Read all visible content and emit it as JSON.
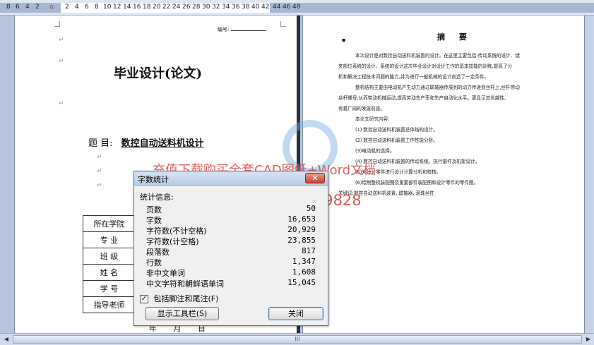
{
  "ruler": {
    "left_ticks": [
      "8",
      "6",
      "4",
      "2"
    ],
    "right_ticks": [
      "2",
      "4",
      "6",
      "8",
      "10",
      "12",
      "14",
      "16",
      "18",
      "20",
      "22",
      "24",
      "26",
      "28",
      "30",
      "32",
      "34",
      "36",
      "38",
      "40",
      "42",
      "44",
      "46",
      "48"
    ]
  },
  "left_page": {
    "serial_label": "编号:",
    "title": "毕业设计(论文)",
    "topic_label": "题      目:",
    "topic_value": "数控自动送料机设计",
    "table_rows": [
      "所在学院",
      "专    业",
      "班    级",
      "姓    名",
      "学    号",
      "指导老师"
    ],
    "date_row": "年 月 日"
  },
  "right_page": {
    "abstract_title": "摘 要",
    "paragraphs": [
      "本次设计是对数控自动送料机装置的设计。在这里主要包括:传动系统的设计、错",
      "夹部位系统的设计、系统的设计这次毕业设计对设计工作的基本技能的训练,提高了分",
      "析和解决工程技术问题的能力,并为进行一般机械的设计创造了一定条件。",
      "整机结构主要由电动机产生动力通过联轴器传展到的动力传递到丝杆上,丝杆带动",
      "丝杆螺母,从而带动机械运动,提高劳动生产率和生产自动化水平。更显示其优越性,",
      "有着广阔的发展前途。",
      "本论文研究内容:",
      "(1) 数控自动送料机装置总体结构设计。",
      "(2) 数控自动送料机装置工作性能分析。",
      "(3)电动机的选择。",
      "(4) 数控自动送料机装置的传动系统、执行部件及机架设计。",
      "(5)对设计零件进行设计计算分析和校核。",
      "(6)绘制整机装配图及重要部件装配图和设计零件的零件图。",
      "关键词:数控自动送料机装置, 联轴器, 滚珠丝杠"
    ]
  },
  "watermark": {
    "line1": "充值下载购买全套CAD图纸+Word文档",
    "line2": "咨询请联系 QQ 401339828"
  },
  "dialog": {
    "title": "字数统计",
    "close_glyph": "✕",
    "section_label": "统计信息:",
    "stats": [
      {
        "label": "页数",
        "value": "50"
      },
      {
        "label": "字数",
        "value": "16,653"
      },
      {
        "label": "字符数(不计空格)",
        "value": "20,929"
      },
      {
        "label": "字符数(计空格)",
        "value": "23,855"
      },
      {
        "label": "段落数",
        "value": "817"
      },
      {
        "label": "行数",
        "value": "1,347"
      },
      {
        "label": "非中文单词",
        "value": "1,608"
      },
      {
        "label": "中文字符和朝鲜语单词",
        "value": "15,045"
      }
    ],
    "checkbox_label": "包括脚注和尾注(F)",
    "checkbox_checked": true,
    "checkmark": "✓",
    "btn_toolbar": "显示工具栏(S)",
    "btn_close": "关闭"
  },
  "scrollbar": {
    "grip": "III",
    "left_arrow": "◀",
    "right_arrow": "▶"
  }
}
